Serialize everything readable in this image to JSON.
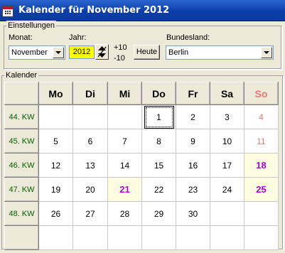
{
  "window": {
    "title": "Kalender für November 2012",
    "icon": "calendar-icon"
  },
  "settings": {
    "legend": "Einstellungen",
    "month_label": "Monat:",
    "month_value": "November",
    "year_label": "Jahr:",
    "year_value": "2012",
    "year_plus": "+10",
    "year_minus": "-10",
    "today_button": "Heute",
    "state_label": "Bundesland:",
    "state_value": "Berlin"
  },
  "calendar": {
    "legend": "Kalender",
    "weekdays": [
      "Mo",
      "Di",
      "Mi",
      "Do",
      "Fr",
      "Sa",
      "So"
    ],
    "weeks": [
      {
        "label": "44. KW",
        "days": [
          "",
          "",
          "",
          "1",
          "2",
          "3",
          "4"
        ]
      },
      {
        "label": "45. KW",
        "days": [
          "5",
          "6",
          "7",
          "8",
          "9",
          "10",
          "11"
        ]
      },
      {
        "label": "46. KW",
        "days": [
          "12",
          "13",
          "14",
          "15",
          "16",
          "17",
          "18"
        ]
      },
      {
        "label": "47. KW",
        "days": [
          "19",
          "20",
          "21",
          "22",
          "23",
          "24",
          "25"
        ]
      },
      {
        "label": "48. KW",
        "days": [
          "26",
          "27",
          "28",
          "29",
          "30",
          "",
          ""
        ]
      },
      {
        "label": "",
        "days": [
          "",
          "",
          "",
          "",
          "",
          "",
          ""
        ]
      }
    ],
    "today": "1",
    "highlighted_days": [
      "18",
      "21",
      "25"
    ],
    "colors": {
      "holiday": "#b000d0",
      "sunday": "#e87878",
      "week_label": "#006400",
      "year_field": "#ffff00"
    }
  }
}
